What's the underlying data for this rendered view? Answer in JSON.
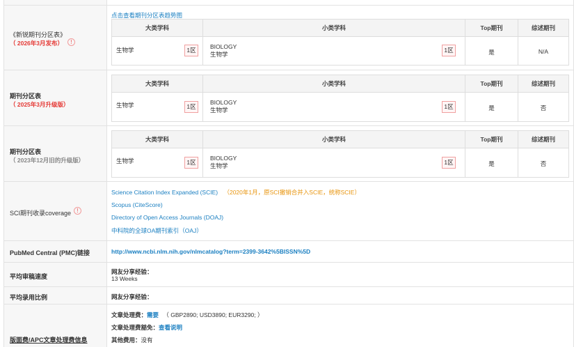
{
  "trend_link": "点击查看期刊分区表趋势图",
  "table_headers": {
    "major": "大类学科",
    "minor": "小类学科",
    "top": "Top期刊",
    "review": "综述期刊"
  },
  "partitions": [
    {
      "title": "《新锐期刊分区表》",
      "subtitle": "（ 2026年3月发布）",
      "has_info": true,
      "major": "生物学",
      "major_zone": "1区",
      "minor_en": "BIOLOGY",
      "minor_cn": "生物学",
      "minor_zone": "1区",
      "top": "是",
      "review": "N/A"
    },
    {
      "title": "期刊分区表",
      "subtitle": "（ 2025年3月升级版）",
      "major": "生物学",
      "major_zone": "1区",
      "minor_en": "BIOLOGY",
      "minor_cn": "生物学",
      "minor_zone": "1区",
      "top": "是",
      "review": "否"
    },
    {
      "title": "期刊分区表",
      "subtitle": "（ 2023年12月旧的升级版）",
      "major": "生物学",
      "major_zone": "1区",
      "minor_en": "BIOLOGY",
      "minor_cn": "生物学",
      "minor_zone": "1区",
      "top": "是",
      "review": "否"
    }
  ],
  "coverage": {
    "label": "SCI期刊收录coverage",
    "items": [
      {
        "text": "Science Citation Index Expanded (SCIE)",
        "note": "（2020年1月，原SCI撤销合并入SCIE，统称SCIE）"
      },
      {
        "text": "Scopus (CiteScore)"
      },
      {
        "text": "Directory of Open Access Journals (DOAJ)"
      },
      {
        "text": "中科院的全球OA期刊索引（OAJ）"
      }
    ]
  },
  "pmc": {
    "label": "PubMed Central (PMC)链接",
    "url": "http://www.ncbi.nlm.nih.gov/nlmcatalog?term=2399-3642%5BISSN%5D"
  },
  "review_speed": {
    "label": "平均审稿速度",
    "heading": "网友分享经验：",
    "value": "13 Weeks"
  },
  "acceptance": {
    "label": "平均录用比例",
    "heading": "网友分享经验："
  },
  "apc": {
    "label": "版面费/APC文章处理费信息",
    "fee_label": "文章处理费：",
    "fee_link": "需要",
    "fee_detail": "（ GBP2890; USD3890; EUR3290; ）",
    "waiver_label": "文章处理费豁免：",
    "waiver_link": "查看说明",
    "other_label": "其他费用：",
    "other_value": "没有"
  }
}
